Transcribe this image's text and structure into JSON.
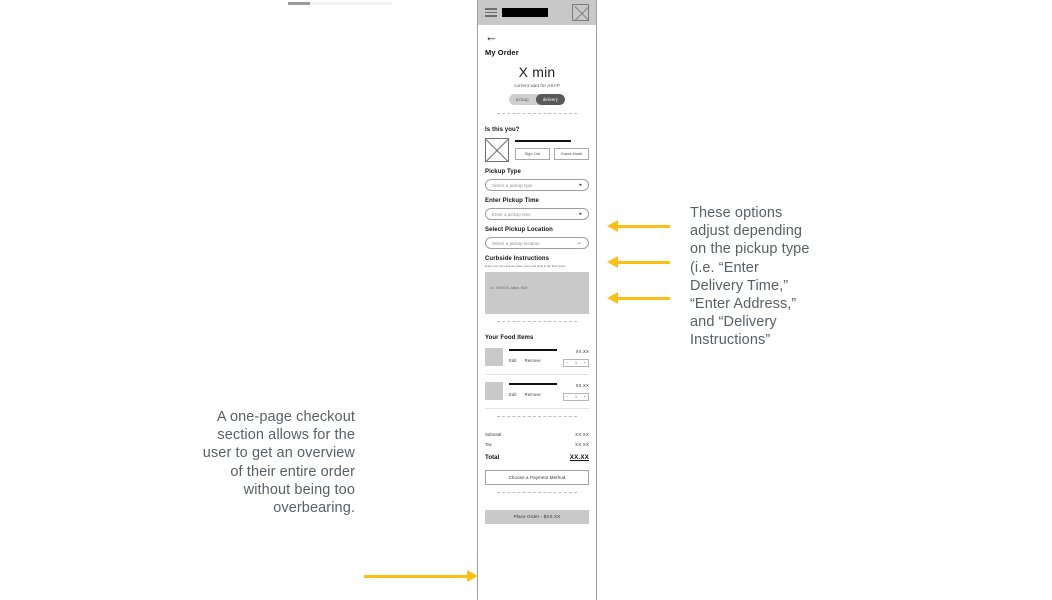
{
  "header": {
    "menu_icon": "hamburger-icon",
    "logo_placeholder": "",
    "close_icon": "x-box-icon"
  },
  "screen": {
    "back_icon": "back-arrow-icon",
    "page_title": "My Order",
    "wait": {
      "time": "X min",
      "subtitle": "current wait for ASAP",
      "toggle_options": [
        "pickup",
        "delivery"
      ],
      "toggle_selected": "delivery"
    },
    "identity": {
      "label": "Is this you?",
      "avatar": "avatar-placeholder",
      "sign_out_label": "Sign Out",
      "guest_mode_label": "Guest Mode"
    },
    "pickup_type": {
      "label": "Pickup Type",
      "placeholder": "Select a pickup type",
      "chevron": "chevron-right-icon"
    },
    "pickup_time": {
      "label": "Enter Pickup Time",
      "placeholder": "Enter a pickup time",
      "chevron": "chevron-right-icon"
    },
    "pickup_location": {
      "label": "Select Pickup Location",
      "placeholder": "Select a pickup location",
      "arrow": "arrow-right-icon"
    },
    "curbside": {
      "label": "Curbside Instructions",
      "helper": "Enter your car's license plate, color, and build in the field below",
      "placeholder": "i.e. XXXXXX, black, SUV"
    },
    "food": {
      "label": "Your Food Items",
      "items": [
        {
          "title": "",
          "edit_label": "Edit",
          "remove_label": "Remove",
          "price": "XX.XX",
          "qty_minus": "−",
          "qty": "1",
          "qty_plus": "+"
        },
        {
          "title": "",
          "edit_label": "Edit",
          "remove_label": "Remove",
          "price": "XX.XX",
          "qty_minus": "−",
          "qty": "1",
          "qty_plus": "+"
        }
      ]
    },
    "totals": {
      "subtotal_label": "Subtotal",
      "subtotal_value": "XX.XX",
      "tax_label": "Tax",
      "tax_value": "XX.XX",
      "total_label": "Total",
      "total_value": "XX.XX"
    },
    "payment_button": "Choose a Payment Method",
    "place_order_button": "Place Order - $XX.XX"
  },
  "annotations": {
    "left_note": "A one-page checkout section allows for the user to get an overview of their entire order without being too overbearing.",
    "right_note": "These options adjust depending on the pickup type (i.e. “Enter Delivery Time,” “Enter Address,” and “Delivery Instructions”"
  },
  "colors": {
    "arrow": "#fcc014",
    "annotation_text": "#5a5f63",
    "header_bar": "#c8c8c8",
    "placeholder_gray": "#c9c9c9"
  }
}
